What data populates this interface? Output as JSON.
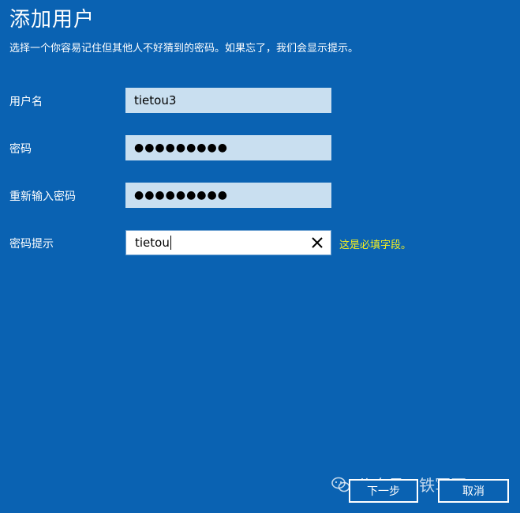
{
  "page": {
    "title": "添加用户",
    "subtitle": "选择一个你容易记住但其他人不好猜到的密码。如果忘了，我们会显示提示。"
  },
  "form": {
    "username": {
      "label": "用户名",
      "value": "tietou3"
    },
    "password": {
      "label": "密码",
      "value": "●●●●●●●●●"
    },
    "confirm": {
      "label": "重新输入密码",
      "value": "●●●●●●●●●"
    },
    "hint": {
      "label": "密码提示",
      "value": "tietou",
      "error": "这是必填字段。"
    }
  },
  "buttons": {
    "next": "下一步",
    "cancel": "取消"
  },
  "watermark": {
    "text": "公众号 · 铁军哥",
    "icon": "wechat-icon"
  },
  "colors": {
    "background": "#0a62b2",
    "field": "#c9dff0",
    "error": "#f6f01f"
  }
}
